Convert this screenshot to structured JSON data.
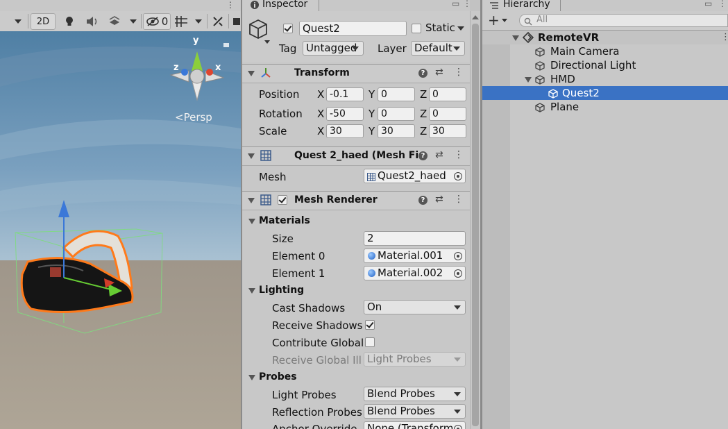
{
  "scene": {
    "toolbar": {
      "mode_2d": "2D",
      "hidden_count": "0"
    },
    "gizmo": {
      "axis_y": "y",
      "axis_x": "x",
      "axis_z": "z",
      "projection": "Persp"
    }
  },
  "inspector": {
    "tab_label": "Inspector",
    "object_name": "Quest2",
    "static_label": "Static",
    "tag_label": "Tag",
    "tag_value": "Untagged",
    "layer_label": "Layer",
    "layer_value": "Default",
    "transform": {
      "title": "Transform",
      "position_label": "Position",
      "rotation_label": "Rotation",
      "scale_label": "Scale",
      "axis_x": "X",
      "axis_y": "Y",
      "axis_z": "Z",
      "position": {
        "x": "-0.1",
        "y": "0",
        "z": "0"
      },
      "rotation": {
        "x": "-50",
        "y": "0",
        "z": "0"
      },
      "scale": {
        "x": "30",
        "y": "30",
        "z": "30"
      }
    },
    "mesh_filter": {
      "title": "Quest 2_haed (Mesh Fi",
      "mesh_label": "Mesh",
      "mesh_value": "Quest2_haed"
    },
    "mesh_renderer": {
      "title": "Mesh Renderer",
      "materials_label": "Materials",
      "size_label": "Size",
      "size_value": "2",
      "element0_label": "Element 0",
      "element0_value": "Material.001",
      "element1_label": "Element 1",
      "element1_value": "Material.002",
      "lighting_label": "Lighting",
      "cast_shadows_label": "Cast Shadows",
      "cast_shadows_value": "On",
      "receive_shadows_label": "Receive Shadows",
      "contribute_global_label": "Contribute Global",
      "receive_global_label": "Receive Global Illu",
      "receive_global_value": "Light Probes",
      "probes_label": "Probes",
      "light_probes_label": "Light Probes",
      "light_probes_value": "Blend Probes",
      "reflection_probes_label": "Reflection Probes",
      "reflection_probes_value": "Blend Probes",
      "anchor_override_label": "Anchor Override",
      "anchor_override_value": "None (Transform"
    }
  },
  "hierarchy": {
    "tab_label": "Hierarchy",
    "search_placeholder": "All",
    "scene_name": "RemoteVR",
    "items": [
      {
        "label": "Main Camera"
      },
      {
        "label": "Directional Light"
      },
      {
        "label": "HMD"
      },
      {
        "label": "Quest2"
      },
      {
        "label": "Plane"
      }
    ],
    "selected_color": "#3a72c4"
  }
}
